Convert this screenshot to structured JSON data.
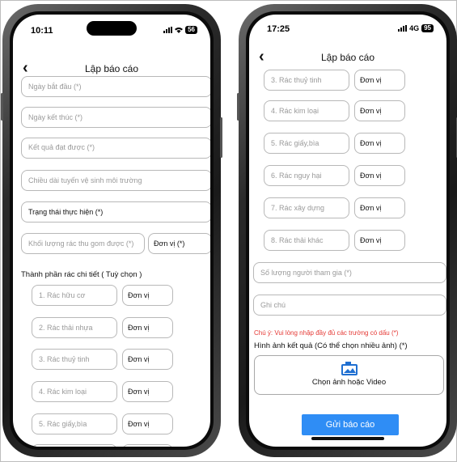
{
  "left": {
    "status": {
      "time": "10:11",
      "battery": "56"
    },
    "title": "Lập báo cáo",
    "fields": {
      "start_date": "Ngày bắt đầu (*)",
      "end_date": "Ngày kết thúc (*)",
      "result": "Kết quả đạt được (*)",
      "length": "Chiều dài tuyến vệ sinh môi trường",
      "status": "Trạng thái thực hiện (*)",
      "weight": "Khối lượng rác thu gom được (*)",
      "weight_unit": "Đơn vị (*)"
    },
    "section_title": "Thành phần rác chi tiết ( Tuỳ chọn )",
    "waste_items": [
      {
        "label": "1. Rác hữu cơ",
        "unit": "Đơn vị"
      },
      {
        "label": "2. Rác thải nhựa",
        "unit": "Đơn vị"
      },
      {
        "label": "3. Rác thuỷ tinh",
        "unit": "Đơn vị"
      },
      {
        "label": "4. Rác kim loại",
        "unit": "Đơn vị"
      },
      {
        "label": "5. Rác giấy,bìa",
        "unit": "Đơn vị"
      }
    ]
  },
  "right": {
    "status": {
      "time": "17:25",
      "network": "4G",
      "battery": "95"
    },
    "title": "Lập báo cáo",
    "waste_items": [
      {
        "label": "3. Rác thuỷ tinh",
        "unit": "Đơn vị"
      },
      {
        "label": "4. Rác kim loại",
        "unit": "Đơn vị"
      },
      {
        "label": "5. Rác giấy,bìa",
        "unit": "Đơn vị"
      },
      {
        "label": "6. Rác nguy hại",
        "unit": "Đơn vị"
      },
      {
        "label": "7. Rác xây dựng",
        "unit": "Đơn vị"
      },
      {
        "label": "8. Rác thải khác",
        "unit": "Đơn vị"
      }
    ],
    "participants": "Số lượng người tham gia (*)",
    "note": "Ghi chú",
    "warning": "Chú ý: Vui lòng nhập đầy đủ các trường có dấu (*)",
    "image_title": "Hình ảnh kết quả (Có thể chọn nhiều ảnh) (*)",
    "upload_label": "Chọn ảnh hoặc Video",
    "submit_label": "Gửi báo cáo"
  },
  "colors": {
    "accent": "#2f8df5",
    "warning": "#e53935",
    "border": "#b8b8b8"
  },
  "icons": [
    "back-chevron-icon",
    "signal-icon",
    "wifi-icon",
    "battery-icon",
    "image-upload-icon"
  ]
}
